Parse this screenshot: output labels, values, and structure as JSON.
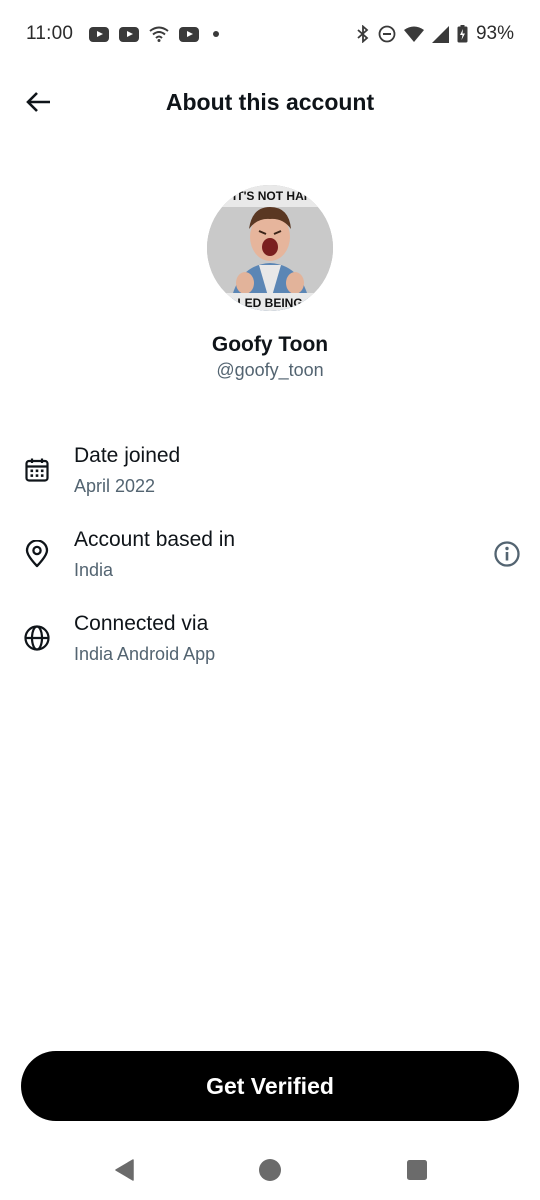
{
  "status_bar": {
    "time": "11:00",
    "battery": "93%",
    "left_icons": [
      "youtube-icon",
      "youtube-icon",
      "wifi-icon",
      "youtube-icon",
      "notification-dot"
    ],
    "right_icons": [
      "bluetooth-icon",
      "do-not-disturb-icon",
      "wifi-icon",
      "signal-icon",
      "battery-icon"
    ]
  },
  "header": {
    "title": "About this account",
    "back_icon": "arrow-left-icon"
  },
  "profile": {
    "display_name": "Goofy Toon",
    "handle": "@goofy_toon",
    "avatar_caption_top": "IT'S NOT HAI",
    "avatar_caption_bottom": "LED BEING"
  },
  "info": [
    {
      "label": "Date joined",
      "value": "April 2022",
      "icon": "calendar-icon"
    },
    {
      "label": "Account based in",
      "value": "India",
      "icon": "location-pin-icon",
      "action_icon": "info-icon"
    },
    {
      "label": "Connected via",
      "value": "India Android App",
      "icon": "globe-icon"
    }
  ],
  "cta": {
    "label": "Get Verified"
  },
  "nav": {
    "back_icon": "nav-back-icon",
    "home_icon": "nav-home-icon",
    "recents_icon": "nav-recents-icon"
  },
  "colors": {
    "primary_text": "#0f1419",
    "secondary_text": "#536471",
    "button_bg": "#000000",
    "button_text": "#ffffff",
    "background": "#ffffff"
  }
}
